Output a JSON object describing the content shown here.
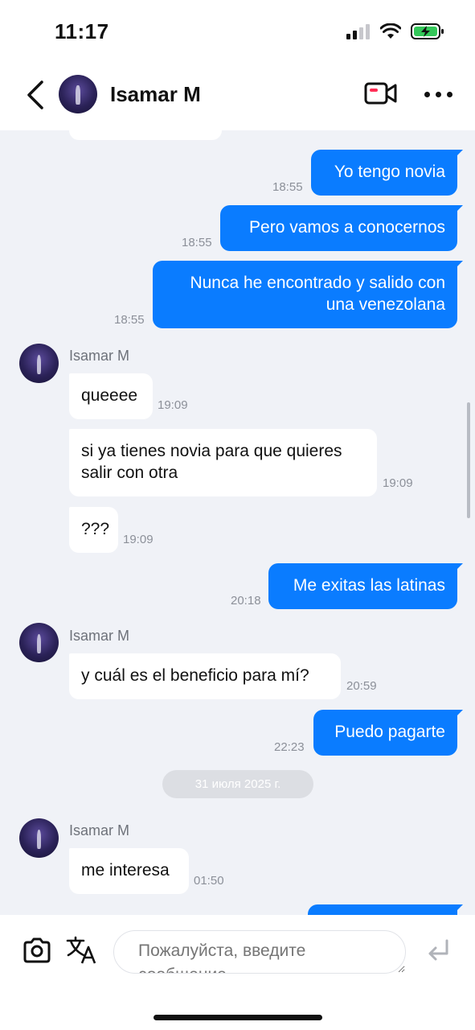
{
  "status_bar": {
    "time": "11:17"
  },
  "header": {
    "name": "Isamar M"
  },
  "messages": {
    "m1": {
      "text": "Yo tengo novia",
      "time": "18:55"
    },
    "m2": {
      "text": "Pero vamos a conocernos",
      "time": "18:55"
    },
    "m3": {
      "line1": "Nunca he encontrado y salido con",
      "line2": "una venezolana",
      "time": "18:55"
    },
    "sender1": "Isamar M",
    "m4": {
      "text": "queeee",
      "time": "19:09"
    },
    "m5": {
      "line1": "si ya tienes novia para que quieres",
      "line2": "salir con otra",
      "time": "19:09"
    },
    "m6": {
      "text": "???",
      "time": "19:09"
    },
    "m7": {
      "text": "Me exitas las latinas",
      "time": "20:18"
    },
    "sender2": "Isamar M",
    "m8": {
      "text": "y cuál es el beneficio para mí?",
      "time": "20:59"
    },
    "m9": {
      "text": "Puedo pagarte",
      "time": "22:23"
    },
    "date_divider": "31 июля 2025 г.",
    "sender3": "Isamar M",
    "m10": {
      "text": "me interesa",
      "time": "01:50"
    }
  },
  "input_bar": {
    "placeholder": "Пожалуйста, введите сообщение"
  },
  "icons": {
    "back": "chevron-left-icon",
    "video": "video-call-icon",
    "more": "more-icon",
    "camera": "camera-icon",
    "translate": "translate-icon",
    "send": "send-return-icon"
  },
  "colors": {
    "outgoing_bubble": "#0a7cff",
    "incoming_bubble": "#ffffff",
    "background": "#f0f2f7"
  }
}
